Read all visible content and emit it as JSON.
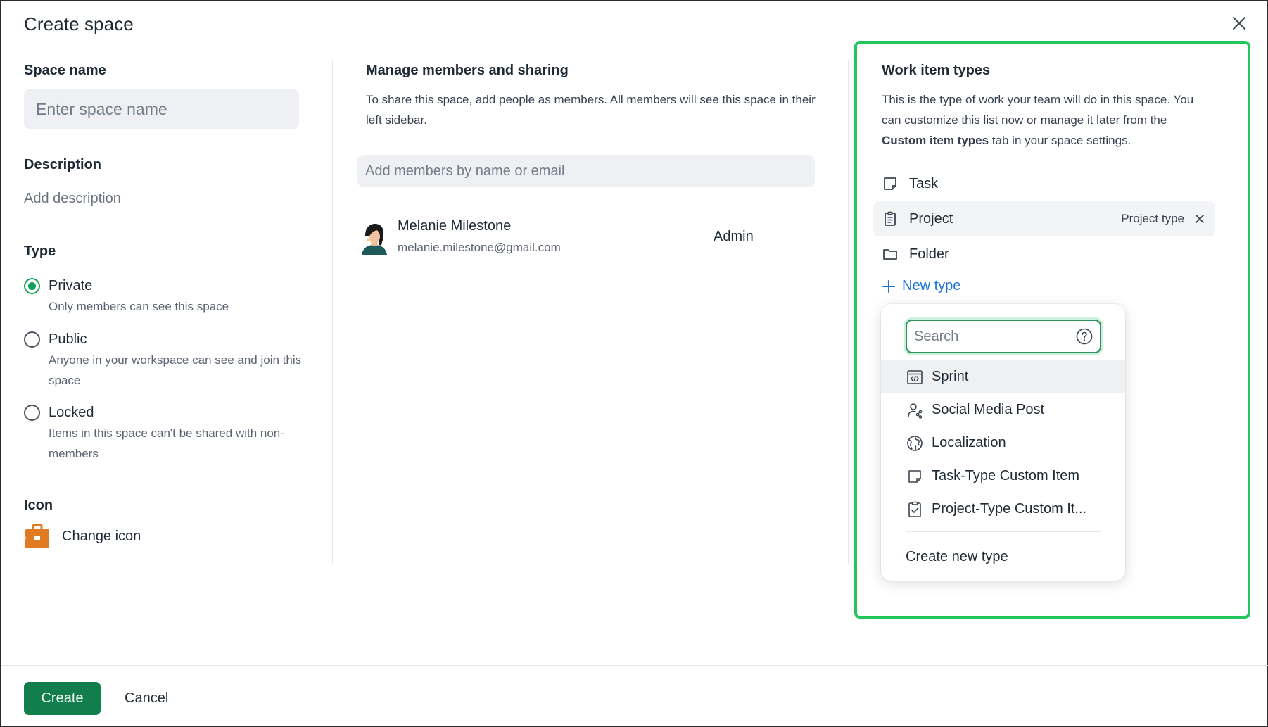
{
  "dialog": {
    "title": "Create space",
    "close_icon": "close-icon"
  },
  "left": {
    "space_name_label": "Space name",
    "space_name_placeholder": "Enter space name",
    "space_name_value": "",
    "description_label": "Description",
    "description_link": "Add description",
    "type_label": "Type",
    "types": [
      {
        "title": "Private",
        "description": "Only members can see this space",
        "selected": true
      },
      {
        "title": "Public",
        "description": "Anyone in your workspace can see and join this space",
        "selected": false
      },
      {
        "title": "Locked",
        "description": "Items in this space can't be shared with non-members",
        "selected": false
      }
    ],
    "icon_label": "Icon",
    "change_icon": "Change icon",
    "icon_name": "briefcase-icon",
    "icon_color": "#e07b24"
  },
  "middle": {
    "title": "Manage members and sharing",
    "description": "To share this space, add people as members. All members will see this space in their left sidebar.",
    "input_placeholder": "Add members by name or email",
    "members": [
      {
        "name": "Melanie Milestone",
        "email": "melanie.milestone@gmail.com",
        "role": "Admin"
      }
    ]
  },
  "right": {
    "title": "Work item types",
    "description_pre": "This is the type of work your team will do in this space. You can customize this list now or manage it later from the ",
    "description_bold": "Custom item types",
    "description_post": " tab in your space settings.",
    "types": [
      {
        "label": "Task",
        "icon": "task-icon"
      },
      {
        "label": "Project",
        "icon": "clipboard-icon",
        "tag": "Project type"
      },
      {
        "label": "Folder",
        "icon": "folder-icon"
      }
    ],
    "new_type": "New type",
    "dropdown": {
      "search_placeholder": "Search",
      "items": [
        {
          "label": "Sprint",
          "icon": "sprint-icon"
        },
        {
          "label": "Social Media Post",
          "icon": "social-media-icon"
        },
        {
          "label": "Localization",
          "icon": "globe-icon"
        },
        {
          "label": "Task-Type Custom Item",
          "icon": "task-icon"
        },
        {
          "label": "Project-Type Custom It...",
          "icon": "clipboard-check-icon"
        }
      ],
      "create_new": "Create new type"
    },
    "highlight_color": "#22c55e"
  },
  "footer": {
    "create": "Create",
    "cancel": "Cancel"
  },
  "colors": {
    "primary": "#127e4c",
    "radio_selected": "#11a25b",
    "link": "#1d74d8"
  }
}
